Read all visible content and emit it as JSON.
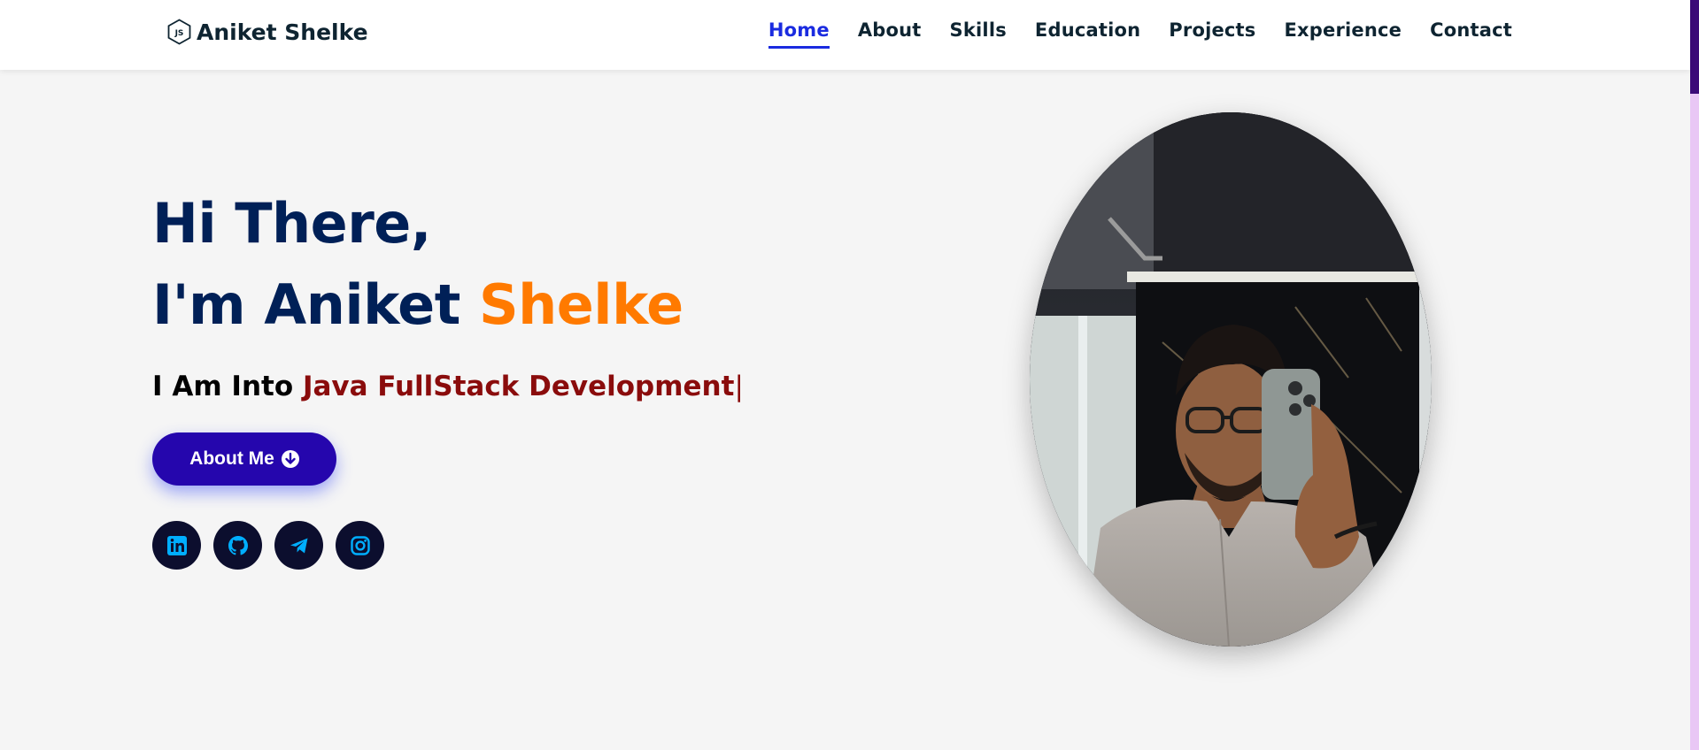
{
  "header": {
    "logo_text": "Aniket Shelke",
    "nav": [
      {
        "label": "Home",
        "active": true
      },
      {
        "label": "About"
      },
      {
        "label": "Skills"
      },
      {
        "label": "Education"
      },
      {
        "label": "Projects"
      },
      {
        "label": "Experience"
      },
      {
        "label": "Contact"
      }
    ]
  },
  "hero": {
    "greeting": "Hi There,",
    "name_prefix": "I'm Aniket",
    "name_accent": "Shelke",
    "role_prefix": "I Am Into",
    "role_typed": "Java FullStack Development",
    "cursor": "|",
    "button_label": "About Me",
    "socials": [
      {
        "icon": "linkedin-icon"
      },
      {
        "icon": "github-icon"
      },
      {
        "icon": "telegram-icon"
      },
      {
        "icon": "instagram-icon"
      }
    ]
  },
  "colors": {
    "heading": "#002057",
    "accent": "#ff7a00",
    "typed": "#8a0c0c",
    "nav_active": "#1a2be0",
    "button": "#2506ad",
    "social_bg": "#0c0e2e",
    "social_icon": "#00aeff"
  }
}
